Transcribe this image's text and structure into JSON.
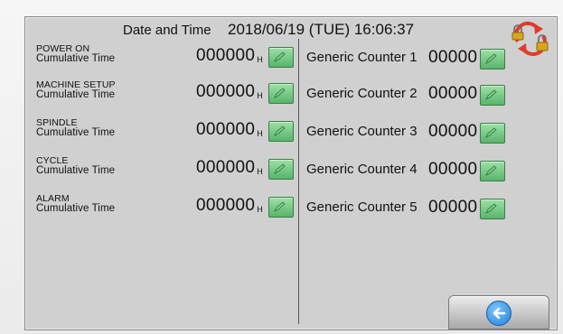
{
  "header": {
    "datetime_label": "Date and Time",
    "datetime_value": "2018/06/19 (TUE) 16:06:37",
    "lock_icon": "lock-refresh-icon"
  },
  "cumulative": [
    {
      "line1": "POWER ON",
      "line2": "Cumulative Time",
      "value": "000000",
      "unit": "H"
    },
    {
      "line1": "MACHINE SETUP",
      "line2": "Cumulative Time",
      "value": "000000",
      "unit": "H"
    },
    {
      "line1": "SPINDLE",
      "line2": "Cumulative Time",
      "value": "000000",
      "unit": "H"
    },
    {
      "line1": "CYCLE",
      "line2": "Cumulative Time",
      "value": "000000",
      "unit": "H"
    },
    {
      "line1": "ALARM",
      "line2": "Cumulative Time",
      "value": "000000",
      "unit": "H"
    }
  ],
  "counters": [
    {
      "label": "Generic Counter 1",
      "value": "00000"
    },
    {
      "label": "Generic Counter 2",
      "value": "00000"
    },
    {
      "label": "Generic Counter 3",
      "value": "00000"
    },
    {
      "label": "Generic Counter 4",
      "value": "00000"
    },
    {
      "label": "Generic Counter 5",
      "value": "00000"
    }
  ],
  "icons": {
    "edit": "edit-pencil-icon",
    "back": "back-arrow-icon"
  },
  "colors": {
    "screen_bg": "#d0d0d0",
    "edit_green": "#58b569",
    "back_blue": "#1f7fd8"
  }
}
